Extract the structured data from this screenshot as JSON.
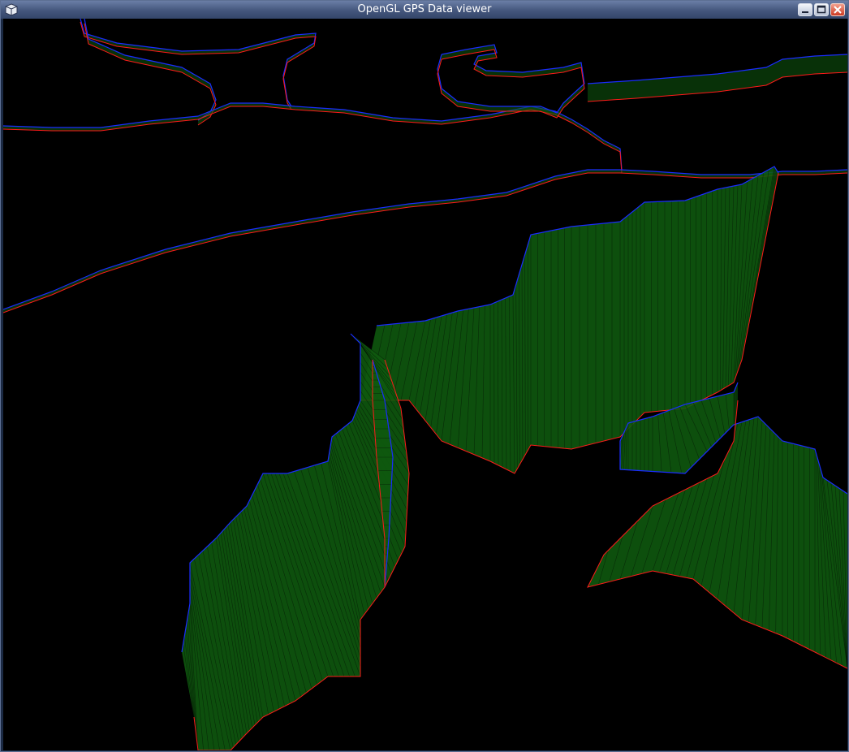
{
  "window": {
    "title": "OpenGL GPS Data viewer",
    "app_icon": "cube-icon",
    "controls": [
      "minimize-icon",
      "maximize-icon",
      "close-icon"
    ]
  },
  "scene": {
    "background_color": "#000000",
    "wall_color": "#0f5a0f",
    "top_line_color": "#1a2cff",
    "bottom_line_color": "#ff1a1a"
  }
}
